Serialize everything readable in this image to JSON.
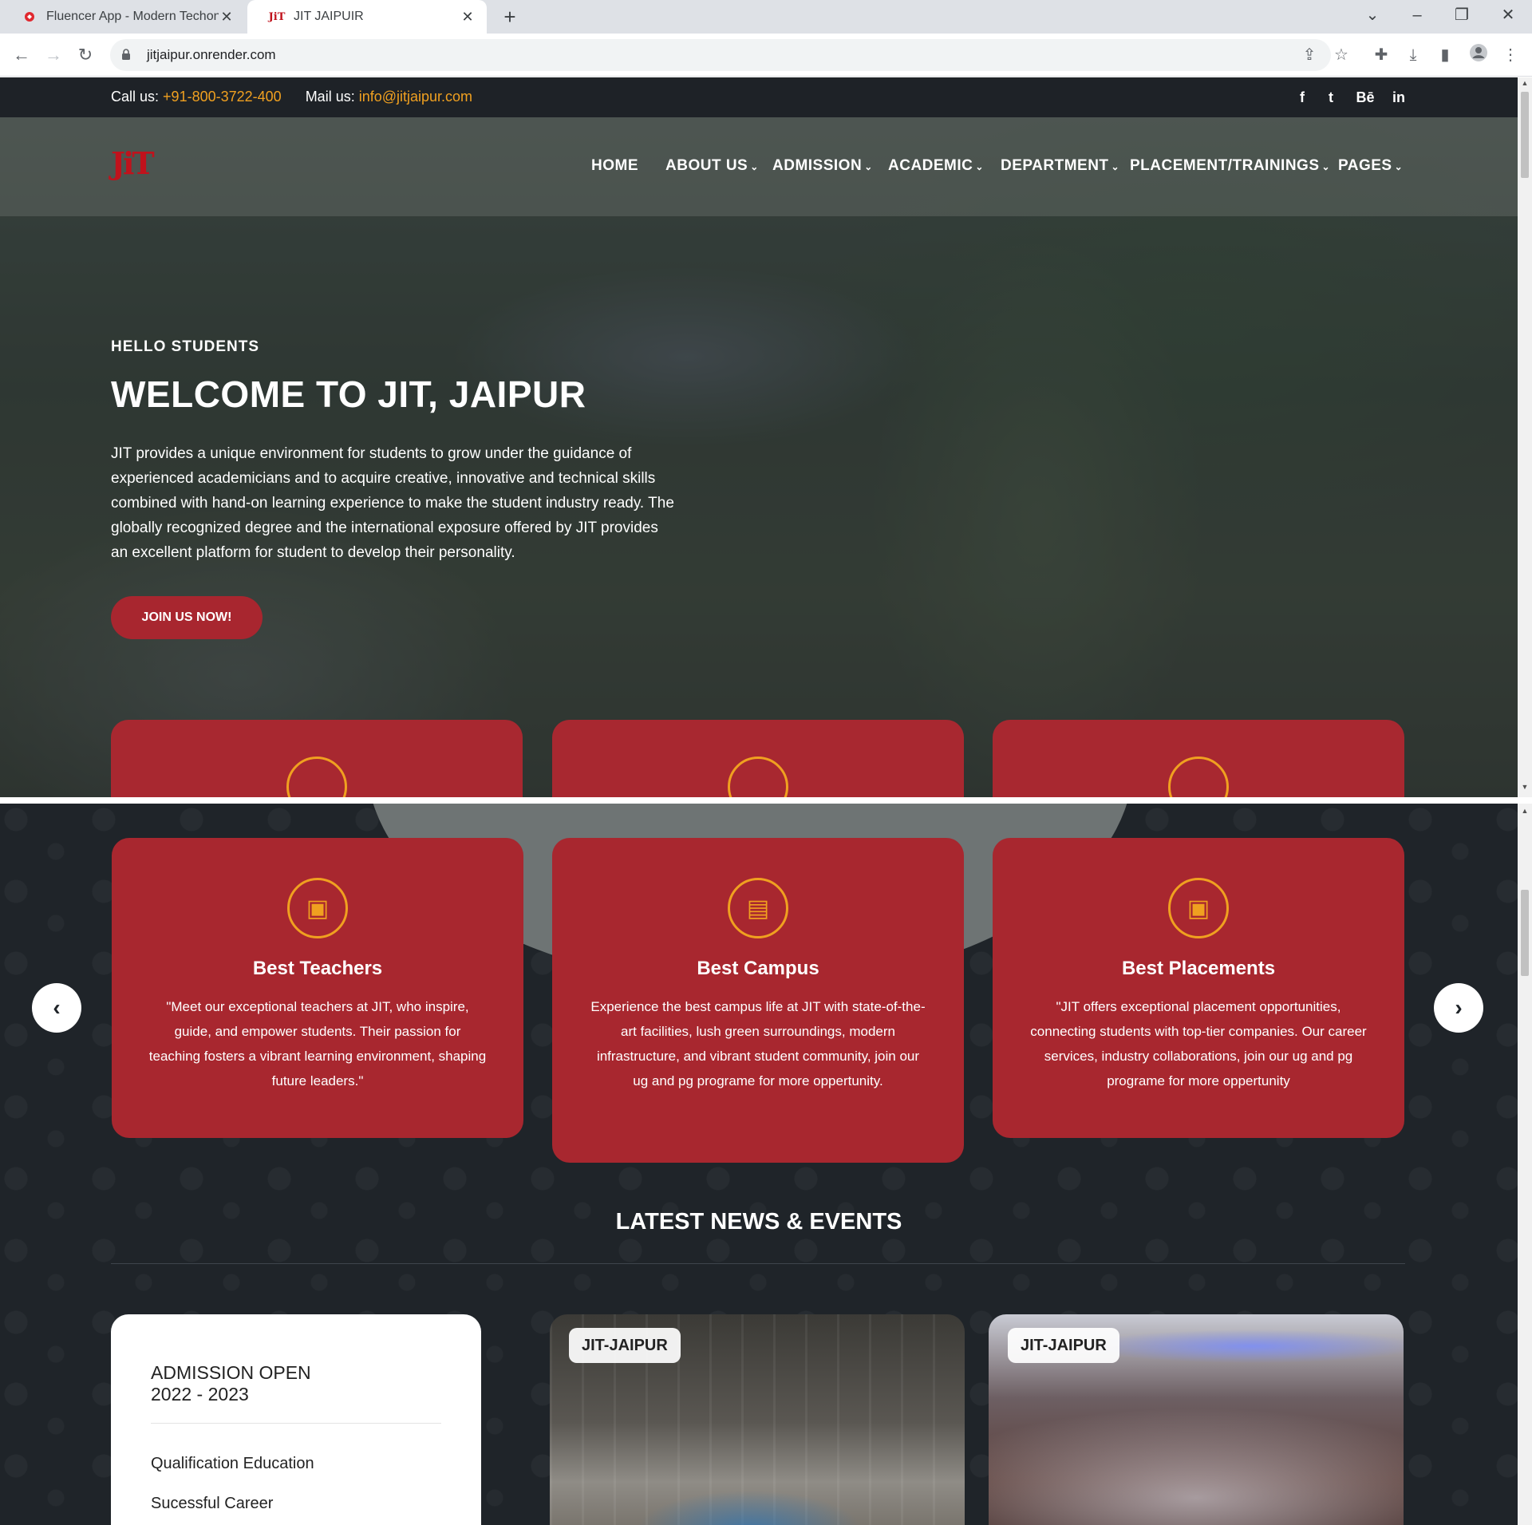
{
  "browser": {
    "tabs": [
      {
        "title": "Fluencer App - Modern Techonol",
        "active": false
      },
      {
        "title": "JIT JAIPUIR",
        "active": true
      }
    ],
    "url": "jitjaipur.onrender.com"
  },
  "topbar": {
    "call_label": "Call us:",
    "call_value": "+91-800-3722-400",
    "mail_label": "Mail us:",
    "mail_value": "info@jitjaipur.com",
    "social": [
      "f",
      "t",
      "Bē",
      "in"
    ]
  },
  "logo_text": "JiT",
  "nav": [
    "HOME",
    "ABOUT US",
    "ADMISSION",
    "ACADEMIC",
    "DEPARTMENT",
    "PLACEMENT/TRAININGS",
    "PAGES"
  ],
  "hero": {
    "subtitle": "HELLO STUDENTS",
    "title": "WELCOME TO JIT, JAIPUR",
    "text": "JIT provides a unique environment for students to grow under the guidance of experienced academicians and to acquire creative, innovative and technical skills combined with hand-on learning experience to make the student industry ready. The globally recognized degree and the international exposure offered by JIT provides an excellent platform for student to develop their personality.",
    "button": "JOIN US NOW!"
  },
  "features": [
    {
      "title": "Best Teachers",
      "text": "\"Meet our exceptional teachers at JIT, who inspire, guide, and empower students. Their passion for teaching fosters a vibrant learning environment, shaping future leaders.\""
    },
    {
      "title": "Best Campus",
      "text": "Experience the best campus life at JIT with state-of-the-art facilities, lush green surroundings, modern infrastructure, and vibrant student community, join our ug and pg programe for more oppertunity."
    },
    {
      "title": "Best Placements",
      "text": "\"JIT offers exceptional placement opportunities, connecting students with top-tier companies. Our career services, industry collaborations, join our ug and pg programe for more oppertunity"
    }
  ],
  "news": {
    "heading": "LATEST NEWS & EVENTS",
    "admission": {
      "title_line1": "ADMISSION OPEN",
      "title_line2": "2022 - 2023",
      "items": [
        "Qualification Education",
        "Sucessful Career"
      ]
    },
    "cards": [
      {
        "tag": "JIT-JAIPUR"
      },
      {
        "tag": "JIT-JAIPUR"
      }
    ]
  },
  "colors": {
    "accent": "#a8272f",
    "highlight": "#f0a020",
    "dark": "#1f2429"
  }
}
